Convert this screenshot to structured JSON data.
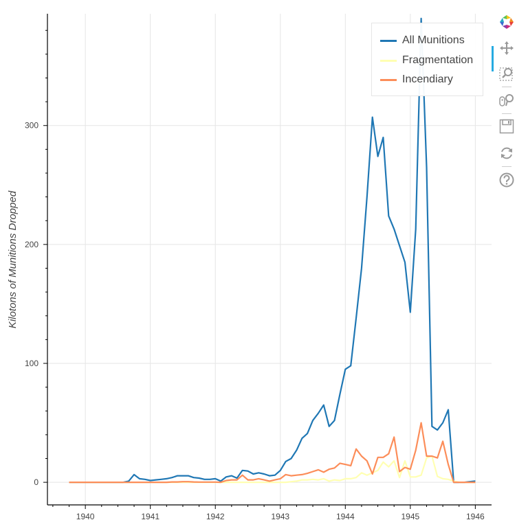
{
  "chart_data": {
    "type": "line",
    "title": "",
    "xlabel": "",
    "ylabel": "Kilotons of Munitions Dropped",
    "x_start": "1939-10",
    "x_frequency": "monthly",
    "x": [
      "1939-10",
      "1939-11",
      "1939-12",
      "1940-01",
      "1940-02",
      "1940-03",
      "1940-04",
      "1940-05",
      "1940-06",
      "1940-07",
      "1940-08",
      "1940-09",
      "1940-10",
      "1940-11",
      "1940-12",
      "1941-01",
      "1941-02",
      "1941-03",
      "1941-04",
      "1941-05",
      "1941-06",
      "1941-07",
      "1941-08",
      "1941-09",
      "1941-10",
      "1941-11",
      "1941-12",
      "1942-01",
      "1942-02",
      "1942-03",
      "1942-04",
      "1942-05",
      "1942-06",
      "1942-07",
      "1942-08",
      "1942-09",
      "1942-10",
      "1942-11",
      "1942-12",
      "1943-01",
      "1943-02",
      "1943-03",
      "1943-04",
      "1943-05",
      "1943-06",
      "1943-07",
      "1943-08",
      "1943-09",
      "1943-10",
      "1943-11",
      "1943-12",
      "1944-01",
      "1944-02",
      "1944-03",
      "1944-04",
      "1944-05",
      "1944-06",
      "1944-07",
      "1944-08",
      "1944-09",
      "1944-10",
      "1944-11",
      "1944-12",
      "1945-01",
      "1945-02",
      "1945-03",
      "1945-04",
      "1945-05",
      "1945-06",
      "1945-07",
      "1945-08",
      "1945-09",
      "1945-10",
      "1945-11",
      "1945-12",
      "1946-01"
    ],
    "x_ticks": [
      "1940",
      "1941",
      "1942",
      "1943",
      "1944",
      "1945",
      "1946"
    ],
    "y_ticks": [
      0,
      100,
      200,
      300
    ],
    "xlim": [
      "1939-06",
      "1946-04"
    ],
    "ylim": [
      -19,
      394
    ],
    "grid": true,
    "legend_position": "top-right",
    "series": [
      {
        "name": "All Munitions",
        "color": "#1f77b4",
        "values": [
          0,
          0,
          0,
          0,
          0,
          0,
          0,
          0,
          0,
          0,
          0,
          1,
          6.5,
          3,
          2.5,
          1.5,
          2,
          2.5,
          3,
          4,
          5.5,
          5.5,
          5.5,
          4,
          3.5,
          2.5,
          2.5,
          3,
          1,
          4.5,
          5.5,
          3.5,
          10,
          9.5,
          7,
          8,
          7,
          5.5,
          6,
          10,
          17.5,
          20,
          27,
          37,
          41,
          52,
          58,
          65,
          47,
          52,
          74,
          95,
          98,
          138,
          180,
          240,
          307,
          274,
          290,
          224,
          213,
          199,
          185,
          143,
          213,
          390,
          265,
          47,
          44,
          50,
          61,
          0,
          0,
          0,
          0.5,
          1
        ]
      },
      {
        "name": "Fragmentation",
        "color": "#ffffb2",
        "values": [
          0,
          0,
          0,
          0,
          0,
          0,
          0,
          0,
          0,
          0,
          0,
          0,
          0,
          0,
          0,
          0,
          0,
          0,
          0,
          0,
          0,
          0,
          0,
          0,
          0,
          0,
          0,
          0,
          0,
          0,
          0,
          0,
          0,
          0,
          0,
          0,
          0,
          0,
          0,
          0,
          0,
          0.5,
          1,
          2,
          2,
          2.5,
          2,
          3,
          1,
          2,
          1.5,
          3,
          3,
          4,
          8,
          6,
          8,
          10,
          17,
          13,
          18,
          4,
          18,
          4.5,
          4.5,
          6,
          20.5,
          22,
          5,
          3,
          2.5,
          1,
          0,
          0,
          0,
          0
        ]
      },
      {
        "name": "Incendiary",
        "color": "#fc8d59",
        "values": [
          0,
          0,
          0,
          0,
          0,
          0,
          0,
          0,
          0,
          0,
          0,
          0,
          0,
          0,
          0,
          0,
          0,
          0,
          0,
          0.3,
          0.3,
          0.5,
          0.5,
          0.3,
          0.2,
          0.2,
          0.2,
          0.2,
          0,
          1.5,
          2,
          2,
          6,
          2,
          2,
          3,
          2,
          1,
          2,
          3,
          6.5,
          5.5,
          6,
          6.5,
          7.5,
          9,
          10.5,
          8.5,
          11,
          12,
          16,
          15,
          14,
          28,
          22,
          18,
          7,
          21,
          21,
          24,
          38,
          9,
          12.5,
          11,
          27,
          50,
          22,
          22,
          20.5,
          34.5,
          15,
          0,
          0,
          0,
          0,
          0
        ]
      }
    ]
  },
  "legend": {
    "items": [
      {
        "label": "All Munitions",
        "color": "#1f77b4"
      },
      {
        "label": "Fragmentation",
        "color": "#ffffb2"
      },
      {
        "label": "Incendiary",
        "color": "#fc8d59"
      }
    ]
  },
  "toolbar": {
    "tools": [
      {
        "name": "bokeh-logo",
        "active": false
      },
      {
        "name": "pan",
        "active": true
      },
      {
        "name": "box-zoom",
        "active": false
      },
      {
        "name": "wheel-zoom",
        "active": false
      },
      {
        "name": "save",
        "active": false
      },
      {
        "name": "reset",
        "active": false
      },
      {
        "name": "help",
        "active": false
      }
    ]
  }
}
